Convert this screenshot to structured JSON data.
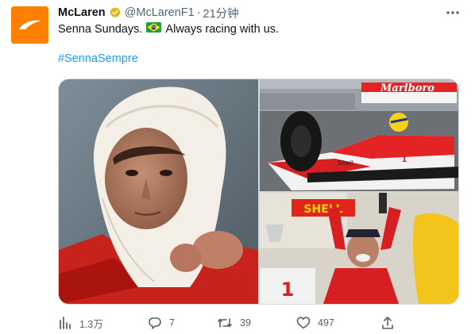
{
  "tweet": {
    "author_name": "McLaren",
    "handle": "@McLarenF1",
    "separator": "·",
    "timestamp": "21分钟",
    "text_before_flag": "Senna Sundays.",
    "flag_emoji": "brazil-flag",
    "text_after_flag": "Always racing with us.",
    "hashtag": "#SennaSempre"
  },
  "media": {
    "photos": [
      {
        "description_icon": "photo"
      },
      {
        "description_icon": "photo",
        "car_number": "1",
        "sponsor_text": "Marlboro",
        "shell_text": "Shell"
      },
      {
        "description_icon": "photo",
        "sign_text": "SHELL",
        "podium_number": "1"
      }
    ]
  },
  "actions": {
    "views": "1.3万",
    "replies": "7",
    "retweets": "39",
    "likes": "497"
  },
  "colors": {
    "brand_orange": "#ff8000",
    "verified_gold": "#e2b719",
    "link_blue": "#1d9bf0",
    "meta_gray": "#536471"
  }
}
